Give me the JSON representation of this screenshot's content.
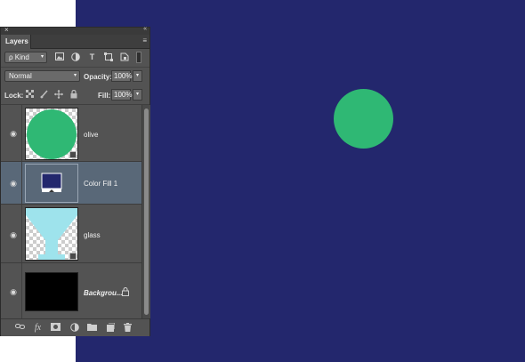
{
  "colors": {
    "canvas_bg": "#23276d",
    "olive_fill": "#2fb874",
    "color_fill": "#23276d",
    "glass_fill": "#9ee3ec",
    "selected_row": "#596878"
  },
  "panel": {
    "tab_label": "Layers",
    "close_glyph": "×",
    "collapse_glyph": "«",
    "menu_glyph": "≡"
  },
  "filter": {
    "kind_label": "ρ Kind",
    "icons": [
      "image-filter-icon",
      "adjustment-filter-icon",
      "type-filter-icon",
      "shape-filter-icon",
      "smart-object-filter-icon"
    ]
  },
  "blend": {
    "mode": "Normal",
    "opacity_label": "Opacity:",
    "opacity_value": "100%"
  },
  "lock": {
    "label": "Lock:",
    "fill_label": "Fill:",
    "fill_value": "100%"
  },
  "layers": [
    {
      "name": "olive",
      "thumb": "olive-circle",
      "visible": true,
      "selected": false
    },
    {
      "name": "Color Fill 1",
      "thumb": "color-fill",
      "visible": true,
      "selected": true
    },
    {
      "name": "glass",
      "thumb": "glass-shape",
      "visible": true,
      "selected": false
    },
    {
      "name": "Backgrou...",
      "thumb": "black-fill",
      "visible": true,
      "selected": false,
      "locked": true
    }
  ],
  "bottom_icons": [
    "link-layers-icon",
    "fx-icon",
    "add-mask-icon",
    "adjustment-layer-icon",
    "new-group-icon",
    "new-layer-icon",
    "delete-layer-icon"
  ],
  "glyphs": {
    "arrow": "▾",
    "eye": "◉",
    "padlock": "🔒",
    "fx": "fx"
  }
}
